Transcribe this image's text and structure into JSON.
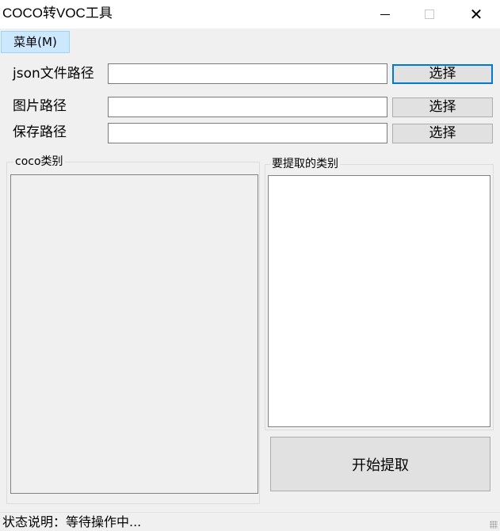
{
  "window": {
    "title": "COCO转VOC工具"
  },
  "menu": {
    "label": "菜单(M)"
  },
  "form": {
    "json_label": "json文件路径",
    "json_value": "",
    "image_label": "图片路径",
    "image_value": "",
    "save_label": "保存路径",
    "save_value": "",
    "select_label": "选择"
  },
  "lists": {
    "coco_title": "coco类别",
    "extract_title": "要提取的类别"
  },
  "actions": {
    "start_label": "开始提取"
  },
  "status": {
    "text": "状态说明：等待操作中..."
  },
  "icons": {
    "minimize": "minimize-icon",
    "maximize": "maximize-icon",
    "close": "close-icon"
  },
  "colors": {
    "focus_border": "#0078d7",
    "menu_highlight": "#cce8ff"
  }
}
